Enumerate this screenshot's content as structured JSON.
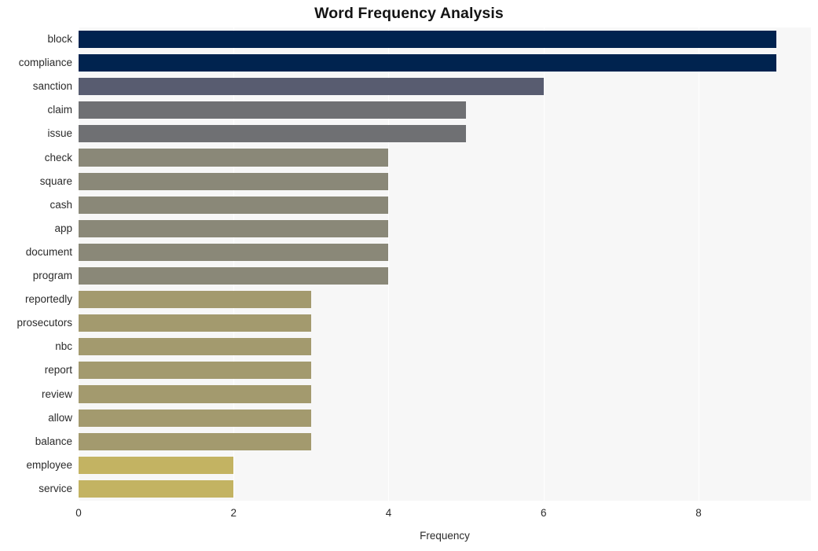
{
  "chart_data": {
    "type": "bar",
    "orientation": "horizontal",
    "title": "Word Frequency Analysis",
    "xlabel": "Frequency",
    "ylabel": "",
    "xlim": [
      0,
      9.45
    ],
    "xticks": [
      0,
      2,
      4,
      6,
      8
    ],
    "xtick_labels": [
      "0",
      "2",
      "4",
      "6",
      "8"
    ],
    "grid": true,
    "grid_axis": "x",
    "legend": null,
    "categories": [
      "block",
      "compliance",
      "sanction",
      "claim",
      "issue",
      "check",
      "square",
      "cash",
      "app",
      "document",
      "program",
      "reportedly",
      "prosecutors",
      "nbc",
      "report",
      "review",
      "allow",
      "balance",
      "employee",
      "service"
    ],
    "values": [
      9,
      9,
      6,
      5,
      5,
      4,
      4,
      4,
      4,
      4,
      4,
      3,
      3,
      3,
      3,
      3,
      3,
      3,
      2,
      2
    ],
    "bar_colors": [
      "#00234f",
      "#00234f",
      "#585c70",
      "#6f7073",
      "#6f7073",
      "#8a8878",
      "#8a8878",
      "#8a8878",
      "#8a8878",
      "#8a8878",
      "#8a8878",
      "#a39a6e",
      "#a39a6e",
      "#a39a6e",
      "#a39a6e",
      "#a39a6e",
      "#a39a6e",
      "#a39a6e",
      "#c3b362",
      "#c3b362"
    ],
    "plot_background": "#f7f7f7",
    "figure_background": "#ffffff",
    "title_color": "#141414",
    "tick_color": "#2b2b2b"
  }
}
